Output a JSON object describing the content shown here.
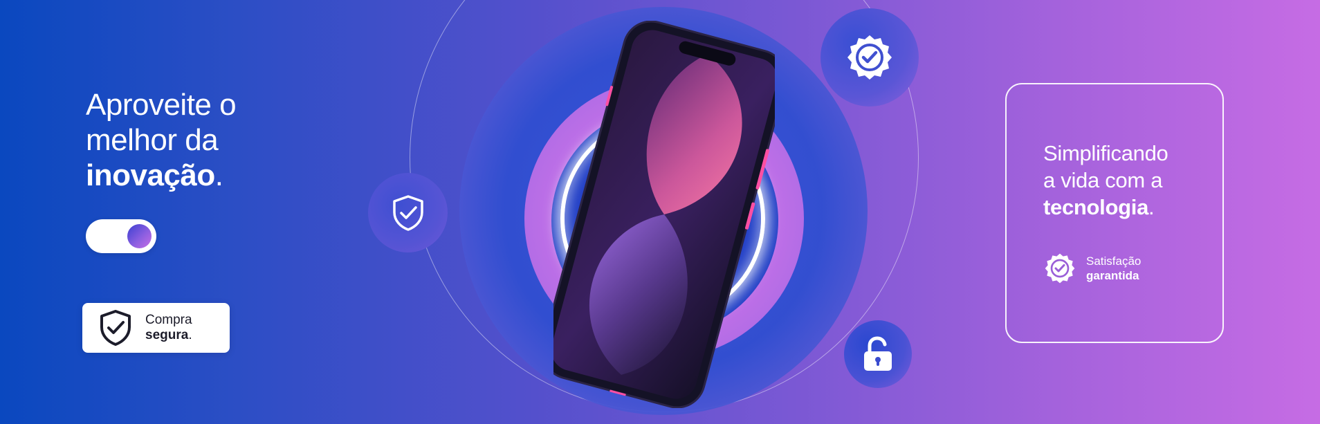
{
  "hero": {
    "line1": "Aproveite o",
    "line2": "melhor da",
    "line3_strong": "inovação",
    "line3_punct": "."
  },
  "toggle": {
    "state": "on"
  },
  "secure_badge": {
    "line1": "Compra",
    "line2_strong": "segura",
    "line2_punct": ".",
    "icon": "shield-check-icon"
  },
  "card": {
    "line1": "Simplificando",
    "line2": "a vida com a",
    "line3_strong": "tecnologia",
    "line3_punct": ".",
    "badge_line1": "Satisfação",
    "badge_line2": "garantida",
    "badge_icon": "seal-check-icon"
  },
  "icons": {
    "top": "seal-check-icon",
    "left": "shield-check-icon",
    "bottom": "unlock-icon"
  },
  "colors": {
    "gradient_left": "#0a48bf",
    "gradient_right": "#c66ce4",
    "accent_pink": "#ff4fa3",
    "white": "#ffffff"
  }
}
